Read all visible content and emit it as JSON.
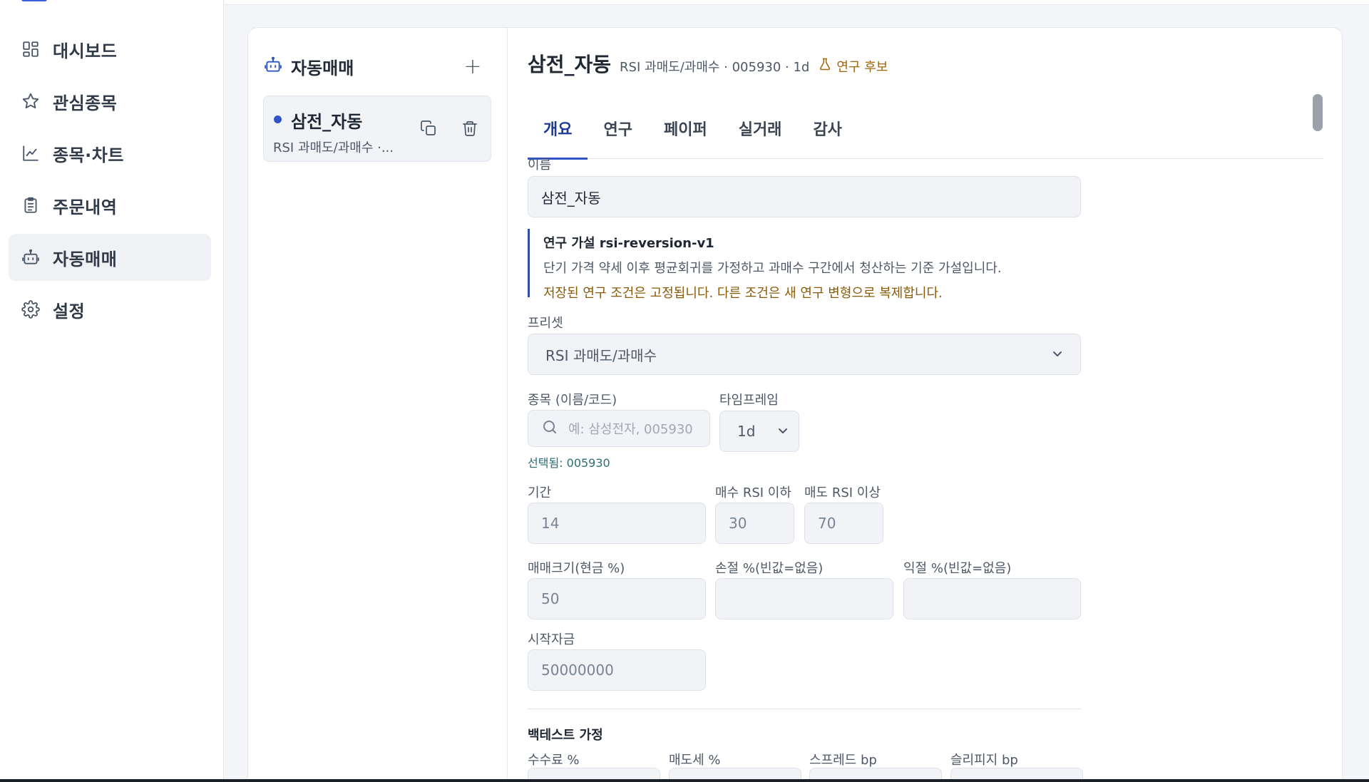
{
  "sidebar": {
    "items": [
      {
        "label": "대시보드",
        "icon": "dashboard-icon"
      },
      {
        "label": "관심종목",
        "icon": "star-icon"
      },
      {
        "label": "종목·차트",
        "icon": "line-chart-icon"
      },
      {
        "label": "주문내역",
        "icon": "clipboard-icon"
      },
      {
        "label": "자동매매",
        "icon": "robot-icon",
        "active": true
      },
      {
        "label": "설정",
        "icon": "gear-icon"
      }
    ]
  },
  "list": {
    "title": "자동매매",
    "add_label": "+",
    "items": [
      {
        "name": "삼전_자동",
        "desc": "RSI 과매도/과매수 ·..."
      }
    ]
  },
  "detail": {
    "title": "삼전_자동",
    "meta": "RSI 과매도/과매수 · 005930 · 1d",
    "badge": "연구 후보",
    "tabs": [
      {
        "label": "개요",
        "active": true
      },
      {
        "label": "연구"
      },
      {
        "label": "페이퍼"
      },
      {
        "label": "실거래"
      },
      {
        "label": "감사"
      }
    ],
    "name_label": "이름",
    "name_value": "삼전_자동",
    "hypothesis": {
      "title": "연구 가설 rsi-reversion-v1",
      "description": "단기 가격 약세 이후 평균회귀를 가정하고 과매수 구간에서 청산하는 기준 가설입니다.",
      "warning": "저장된 연구 조건은 고정됩니다. 다른 조건은 새 연구 변형으로 복제합니다."
    },
    "preset_label": "프리셋",
    "preset_value": "RSI 과매도/과매수",
    "symbol_label": "종목 (이름/코드)",
    "symbol_placeholder": "예: 삼성전자, 005930",
    "timeframe_label": "타임프레임",
    "timeframe_value": "1d",
    "selected_text": "선택됨: 005930",
    "period_label": "기간",
    "period_value": "14",
    "buy_rsi_label": "매수 RSI 이하",
    "buy_rsi_value": "30",
    "sell_rsi_label": "매도 RSI 이상",
    "sell_rsi_value": "70",
    "trade_size_label": "매매크기(현금 %)",
    "trade_size_value": "50",
    "stop_loss_label": "손절 %(빈값=없음)",
    "stop_loss_value": "",
    "take_profit_label": "익절 %(빈값=없음)",
    "take_profit_value": "",
    "capital_label": "시작자금",
    "capital_value": "50000000",
    "backtest_title": "백테스트 가정",
    "fee_label": "수수료 %",
    "tax_label": "매도세 %",
    "spread_label": "스프레드 bp",
    "slippage_label": "슬리피지 bp"
  },
  "colors": {
    "accent": "#2f55c6",
    "warning": "#a0660b",
    "selected_text": "#2b6e75"
  }
}
